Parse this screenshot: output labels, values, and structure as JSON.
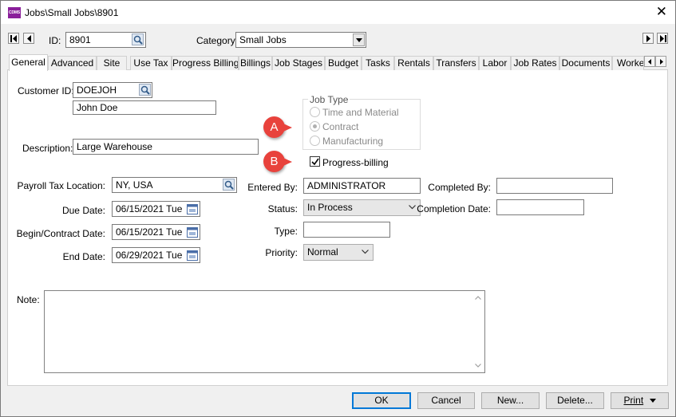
{
  "window": {
    "title": "Jobs\\Small Jobs\\8901",
    "app_icon_text": "CDMS"
  },
  "header": {
    "id_label": "ID:",
    "id_value": "8901",
    "category_label": "Category:",
    "category_value": "Small Jobs"
  },
  "tabs": [
    {
      "label": "General"
    },
    {
      "label": "Advanced"
    },
    {
      "label": "Site"
    },
    {
      "label": "Use Tax"
    },
    {
      "label": "Progress Billing"
    },
    {
      "label": "Billings"
    },
    {
      "label": "Job Stages"
    },
    {
      "label": "Budget"
    },
    {
      "label": "Tasks"
    },
    {
      "label": "Rentals"
    },
    {
      "label": "Transfers"
    },
    {
      "label": "Labor"
    },
    {
      "label": "Job Rates"
    },
    {
      "label": "Documents"
    },
    {
      "label": "Worke"
    }
  ],
  "general": {
    "customer_id_label": "Customer ID:",
    "customer_id_value": "DOEJOH",
    "customer_name_value": "John Doe",
    "description_label": "Description:",
    "description_value": "Large Warehouse",
    "job_type": {
      "legend": "Job Type",
      "options": [
        "Time and Material",
        "Contract",
        "Manufacturing"
      ],
      "selected": "Contract"
    },
    "progress_billing_label": "Progress-billing",
    "progress_billing_checked": true,
    "payroll_tax_label": "Payroll Tax Location:",
    "payroll_tax_value": "NY, USA",
    "due_date_label": "Due Date:",
    "due_date_value": "06/15/2021 Tue",
    "begin_date_label": "Begin/Contract Date:",
    "begin_date_value": "06/15/2021 Tue",
    "end_date_label": "End Date:",
    "end_date_value": "06/29/2021 Tue",
    "entered_by_label": "Entered By:",
    "entered_by_value": "ADMINISTRATOR",
    "status_label": "Status:",
    "status_value": "In Process",
    "type_label": "Type:",
    "type_value": "",
    "priority_label": "Priority:",
    "priority_value": "Normal",
    "completed_by_label": "Completed By:",
    "completed_by_value": "",
    "completion_date_label": "Completion Date:",
    "completion_date_value": "",
    "note_label": "Note:",
    "note_value": ""
  },
  "markers": {
    "a": "A",
    "b": "B"
  },
  "buttons": {
    "ok": "OK",
    "cancel": "Cancel",
    "new": "New...",
    "delete": "Delete...",
    "print": "Print"
  },
  "colors": {
    "marker": "#e8423c",
    "app_icon": "#8a1f9a",
    "default_button_border": "#0078d7"
  }
}
